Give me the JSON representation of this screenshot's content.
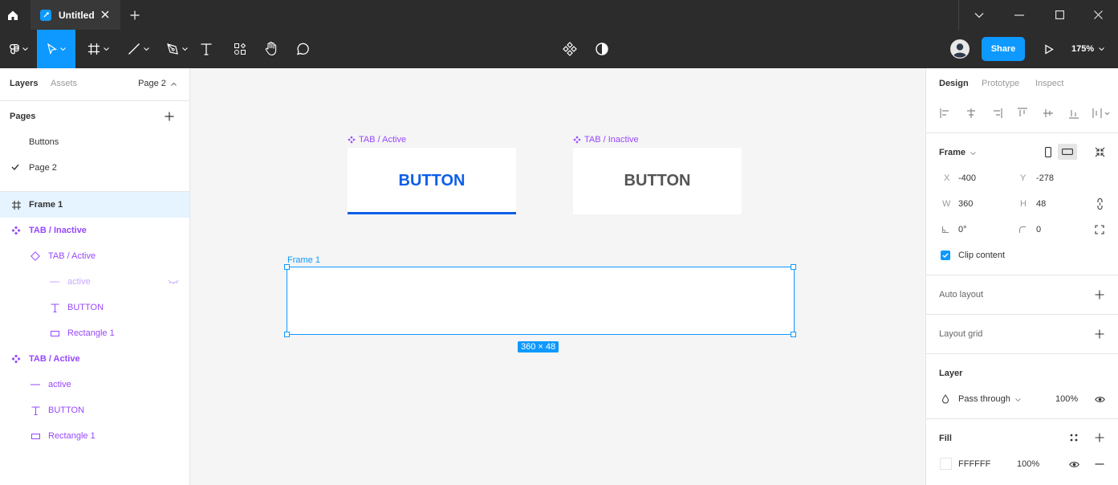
{
  "titlebar": {
    "tab_title": "Untitled"
  },
  "toolbar": {
    "share_label": "Share",
    "zoom_label": "175%"
  },
  "left_panel": {
    "tabs": {
      "layers": "Layers",
      "assets": "Assets"
    },
    "current_page": "Page 2",
    "pages_heading": "Pages",
    "pages": [
      {
        "label": "Buttons",
        "checked": false
      },
      {
        "label": "Page 2",
        "checked": true
      }
    ],
    "layers": [
      {
        "label": "Frame 1",
        "icon": "frame-icon",
        "indent": 0,
        "selected": true
      },
      {
        "label": "TAB / Inactive",
        "icon": "component-icon",
        "indent": 0
      },
      {
        "label": "TAB / Active",
        "icon": "instance-icon",
        "indent": 1
      },
      {
        "label": "active",
        "icon": "line-icon",
        "indent": 2,
        "hidden": true
      },
      {
        "label": "BUTTON",
        "icon": "text-icon",
        "indent": 2
      },
      {
        "label": "Rectangle 1",
        "icon": "rectangle-icon",
        "indent": 2
      },
      {
        "label": "TAB / Active",
        "icon": "component-icon",
        "indent": 0
      },
      {
        "label": "active",
        "icon": "line-icon",
        "indent": 1
      },
      {
        "label": "BUTTON",
        "icon": "text-icon",
        "indent": 1
      },
      {
        "label": "Rectangle 1",
        "icon": "rectangle-icon",
        "indent": 1
      }
    ]
  },
  "canvas": {
    "components": [
      {
        "label": "TAB / Active",
        "button_text": "BUTTON",
        "text_color": "#0d5ee8",
        "underline": true
      },
      {
        "label": "TAB / Inactive",
        "button_text": "BUTTON",
        "text_color": "#555555",
        "underline": false
      }
    ],
    "selected_frame": {
      "label": "Frame 1",
      "size_badge": "360 × 48"
    }
  },
  "right_panel": {
    "tabs": {
      "design": "Design",
      "prototype": "Prototype",
      "inspect": "Inspect"
    },
    "frame_section": {
      "heading": "Frame",
      "x_label": "X",
      "x_value": "-400",
      "y_label": "Y",
      "y_value": "-278",
      "w_label": "W",
      "w_value": "360",
      "h_label": "H",
      "h_value": "48",
      "rotation_value": "0°",
      "radius_value": "0",
      "clip_content_label": "Clip content",
      "clip_content_checked": true
    },
    "auto_layout_label": "Auto layout",
    "layout_grid_label": "Layout grid",
    "layer_section": {
      "heading": "Layer",
      "blend_mode": "Pass through",
      "opacity": "100%"
    },
    "fill_section": {
      "heading": "Fill",
      "hex": "FFFFFF",
      "opacity": "100%"
    }
  },
  "colors": {
    "accent": "#0d99ff",
    "component_purple": "#9747ff",
    "toolbar_bg": "#2c2c2c",
    "canvas_bg": "#f5f5f5"
  }
}
